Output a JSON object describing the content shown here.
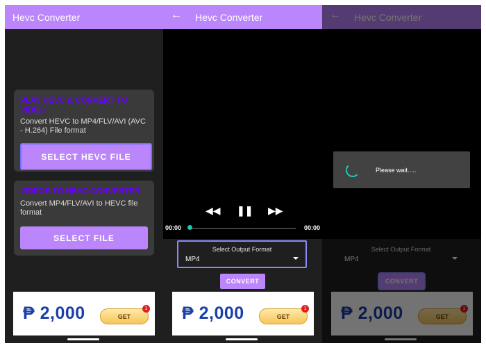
{
  "app": {
    "title": "Hevc Converter"
  },
  "screen1": {
    "card1": {
      "title": "PLAY HEVC & CONVERT TO VIDEO",
      "desc": "Convert HEVC to MP4/FLV/AVI (AVC - H.264) File format",
      "button": "SELECT HEVC FILE"
    },
    "card2": {
      "title": "VIDEOS TO HEVC CONVERTER",
      "desc": "Convert MP4/FLV/AVI to HEVC  file format",
      "button": "SELECT FILE"
    }
  },
  "player": {
    "time_start": "00:00",
    "time_end": "00:00",
    "progress": 0
  },
  "output": {
    "label": "Select Output Format",
    "value": "MP4"
  },
  "convert_label": "CONVERT",
  "dialog": {
    "message": "Please wait....."
  },
  "ad": {
    "price": "₱ 2,000",
    "cta": "GET",
    "badge": "1"
  },
  "colors": {
    "primary": "#bb86fc",
    "card_title": "#6a00ff",
    "accent": "#12c9b3"
  }
}
